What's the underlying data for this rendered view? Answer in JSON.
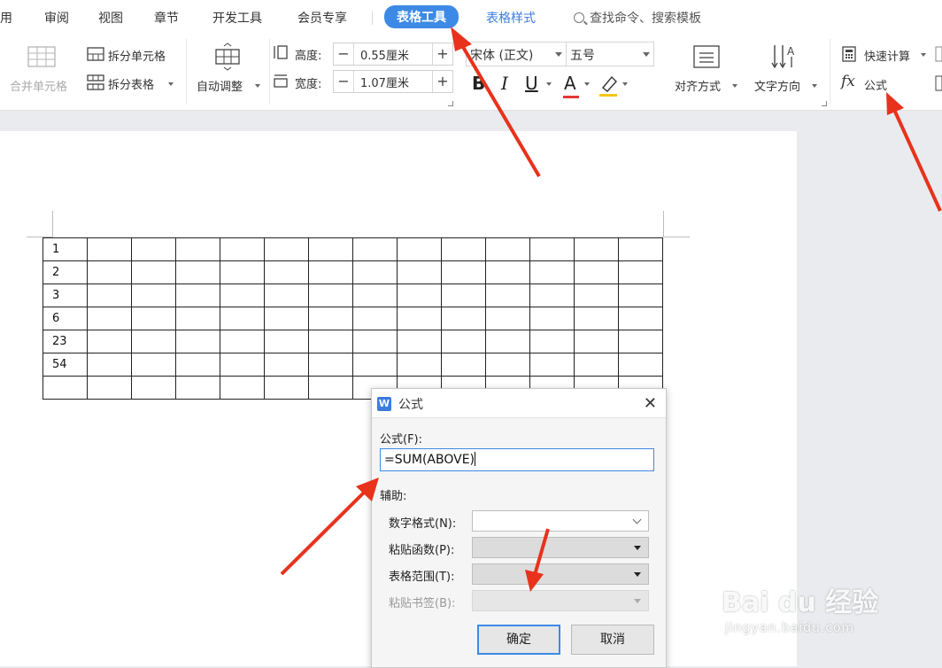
{
  "tabs": {
    "items": [
      "用",
      "审阅",
      "视图",
      "章节",
      "开发工具",
      "会员专享"
    ],
    "active": "表格工具",
    "style": "表格样式",
    "search": "查找命令、搜索模板"
  },
  "ribbon": {
    "merge_cells": "合并单元格",
    "split_cells": "拆分单元格",
    "split_table": "拆分表格",
    "auto_fit": "自动调整",
    "height_label": "高度:",
    "height_value": "0.55厘米",
    "width_label": "宽度:",
    "width_value": "1.07厘米",
    "font_name": "宋体 (正文)",
    "font_size": "五号",
    "align": "对齐方式",
    "text_direction": "文字方向",
    "quick_calc": "快速计算",
    "formula": "公式",
    "fx_glyph": "fx",
    "bold": "B",
    "italic": "I",
    "underline": "U",
    "font_color": "A",
    "font_color_hex": "#e53935",
    "highlight_hex": "#f5c518",
    "accent_hex": "#3d8ae6"
  },
  "table": {
    "columns": 14,
    "first_column": [
      "1",
      "2",
      "3",
      "6",
      "23",
      "54",
      ""
    ]
  },
  "dialog": {
    "title": "公式",
    "logo": "W",
    "close": "✕",
    "formula_label": "公式(F):",
    "formula_value": "=SUM(ABOVE)",
    "assist_label": "辅助:",
    "number_format_label": "数字格式(N):",
    "paste_function_label": "粘贴函数(P):",
    "table_range_label": "表格范围(T):",
    "paste_bookmark_label": "粘贴书签(B):",
    "ok": "确定",
    "cancel": "取消"
  },
  "watermark": {
    "brand": "Bai du 经验",
    "site": "jingyan.baidu.com"
  },
  "annotations": {
    "arrow_color": "#e8321c"
  }
}
